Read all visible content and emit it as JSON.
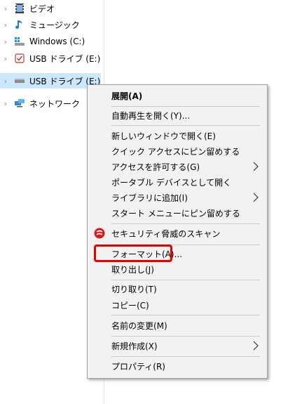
{
  "nav": {
    "items": [
      {
        "label": "ビデオ",
        "icon": "video-folder-icon"
      },
      {
        "label": "ミュージック",
        "icon": "music-folder-icon"
      },
      {
        "label": "Windows (C:)",
        "icon": "windows-drive-icon"
      },
      {
        "label": "USB ドライブ (E:)",
        "icon": "usb-drive-icon"
      },
      {
        "label": "USB ドライブ (E:)",
        "icon": "usb-drive-icon"
      },
      {
        "label": "ネットワーク",
        "icon": "network-icon"
      }
    ]
  },
  "context_menu": {
    "items": [
      {
        "label": "展開(A)"
      },
      {
        "label": "自動再生を開く(Y)..."
      },
      {
        "label": "新しいウィンドウで開く(E)"
      },
      {
        "label": "クイック アクセスにピン留めする"
      },
      {
        "label": "アクセスを許可する(G)"
      },
      {
        "label": "ポータブル デバイスとして開く"
      },
      {
        "label": "ライブラリに追加(I)"
      },
      {
        "label": "スタート メニューにピン留めする"
      },
      {
        "label": "セキュリティ脅威のスキャン"
      },
      {
        "label": "フォーマット(A)..."
      },
      {
        "label": "取り出し(J)"
      },
      {
        "label": "切り取り(T)"
      },
      {
        "label": "コピー(C)"
      },
      {
        "label": "名前の変更(M)"
      },
      {
        "label": "新規作成(X)"
      },
      {
        "label": "プロパティ(R)"
      }
    ]
  },
  "colors": {
    "selection": "#cce8ff",
    "highlight_box": "#e60000",
    "menu_background": "#f2f2f2"
  }
}
